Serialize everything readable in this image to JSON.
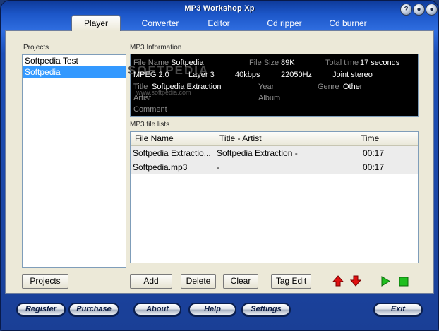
{
  "window": {
    "title": "MP3 Workshop Xp",
    "help_label": "?",
    "minimize_label": "●",
    "close_label": "●"
  },
  "tabs": [
    {
      "label": "Player",
      "active": true
    },
    {
      "label": "Converter"
    },
    {
      "label": "Editor"
    },
    {
      "label": "Cd ripper"
    },
    {
      "label": "Cd burner"
    }
  ],
  "projects": {
    "label": "Projects",
    "items": [
      "Softpedia Test",
      "Softpedia"
    ],
    "selected_index": 1,
    "button_label": "Projects"
  },
  "mp3_info": {
    "label": "MP3 Information",
    "file_name_label": "File Name",
    "file_name": "Softpedia",
    "file_size_label": "File Size",
    "file_size": "89K",
    "total_time_label": "Total time",
    "total_time": "17 seconds",
    "format": "MPEG 2.0",
    "layer": "Layer 3",
    "bitrate": "40kbps",
    "sample_rate": "22050Hz",
    "channel_mode": "Joint stereo",
    "title_label": "Title",
    "title": "Softpedia Extraction",
    "year_label": "Year",
    "genre_label": "Genre",
    "genre": "Other",
    "artist_label": "Artist",
    "album_label": "Album",
    "comment_label": "Comment",
    "watermark": "SOFTPEDIA",
    "watermark_sub": "www.softpedia.com"
  },
  "file_list": {
    "label": "MP3 file lists",
    "columns": [
      "File Name",
      "Title - Artist",
      "Time"
    ],
    "rows": [
      [
        "Softpedia Extractio...",
        "Softpedia Extraction -",
        "00:17"
      ],
      [
        "Softpedia.mp3",
        "-",
        "00:17"
      ]
    ]
  },
  "actions": {
    "add": "Add",
    "delete": "Delete",
    "clear": "Clear",
    "tag_edit": "Tag Edit"
  },
  "bottom_buttons": {
    "register": "Register",
    "purchase": "Purchase",
    "about": "About",
    "help": "Help",
    "settings": "Settings",
    "exit": "Exit"
  },
  "colors": {
    "frame_blue": "#1d4fb8",
    "selection": "#3399ff",
    "arrow_red": "#e01010",
    "play_green": "#1fbf1f"
  }
}
